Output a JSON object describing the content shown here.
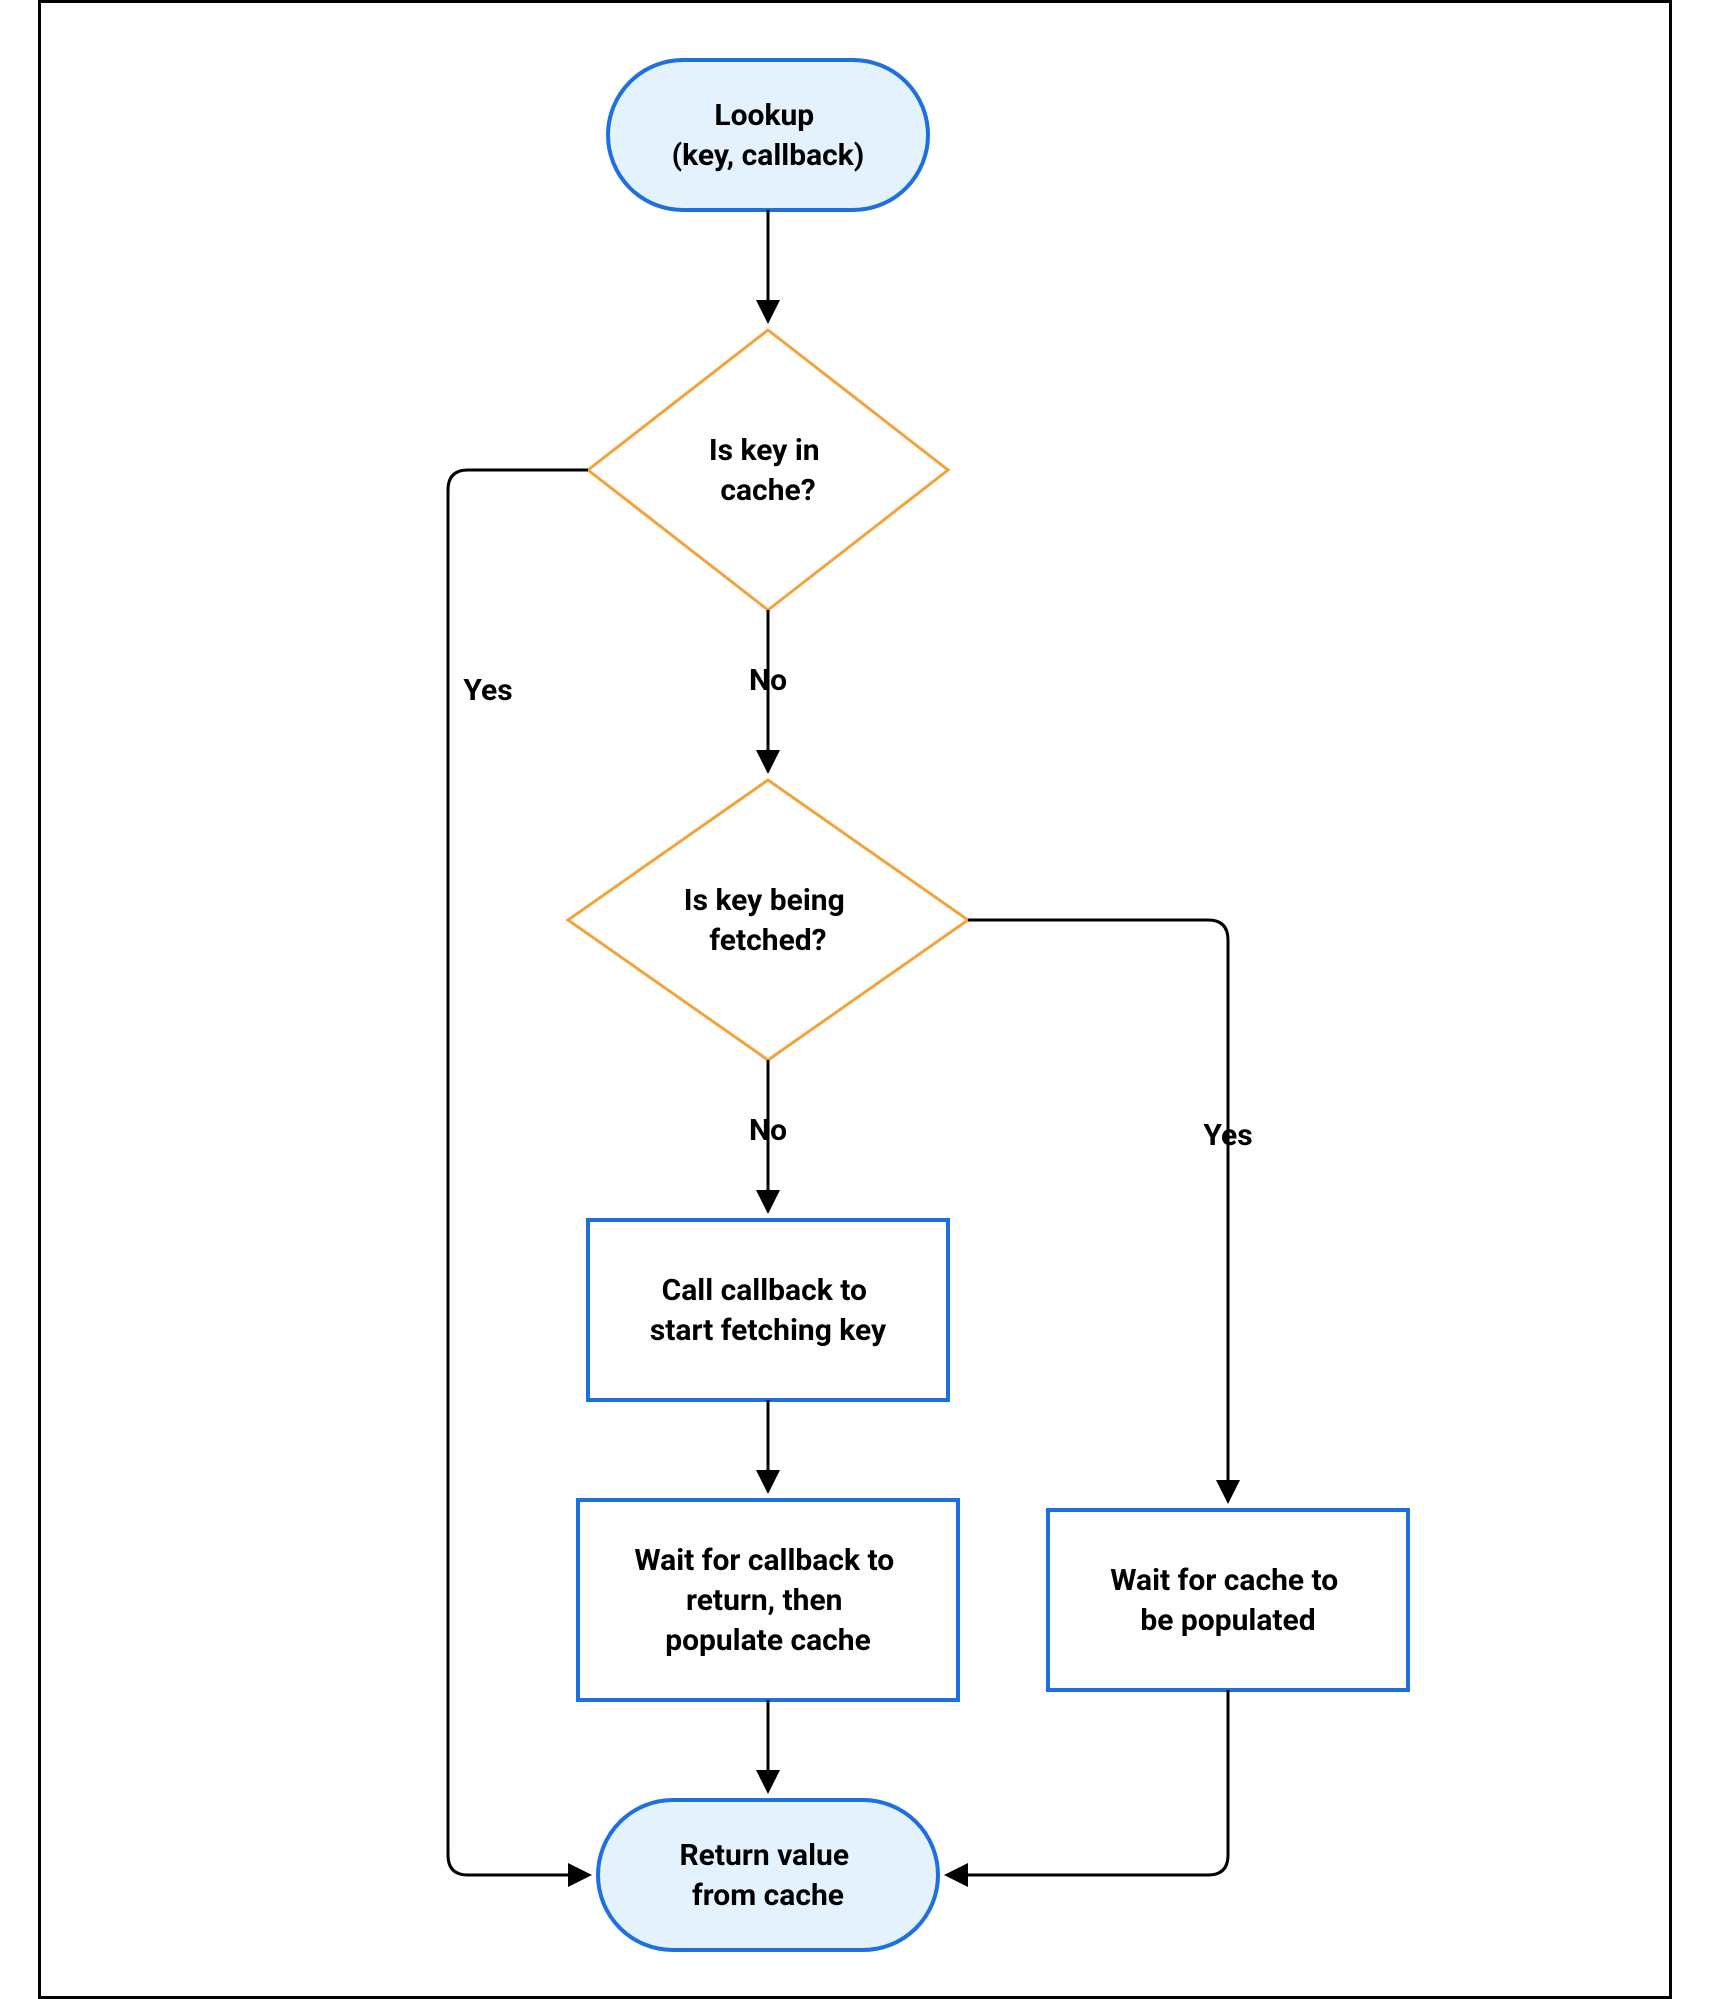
{
  "diagram": {
    "type": "flowchart",
    "nodes": {
      "start": {
        "shape": "terminator",
        "line1": "Lookup",
        "line2": "(key, callback)"
      },
      "decision1": {
        "shape": "decision",
        "line1": "Is key in",
        "line2": "cache?"
      },
      "decision2": {
        "shape": "decision",
        "line1": "Is key being",
        "line2": "fetched?"
      },
      "process1": {
        "shape": "process",
        "line1": "Call callback to",
        "line2": "start fetching key"
      },
      "process2": {
        "shape": "process",
        "line1": "Wait for callback to",
        "line2": "return, then",
        "line3": "populate cache"
      },
      "process3": {
        "shape": "process",
        "line1": "Wait for cache to",
        "line2": "be populated"
      },
      "end": {
        "shape": "terminator",
        "line1": "Return value",
        "line2": "from cache"
      }
    },
    "edges": {
      "e1": {
        "from": "start",
        "to": "decision1",
        "label": ""
      },
      "e2": {
        "from": "decision1",
        "to": "end",
        "label": "Yes",
        "path": "left-down"
      },
      "e3": {
        "from": "decision1",
        "to": "decision2",
        "label": "No"
      },
      "e4": {
        "from": "decision2",
        "to": "process1",
        "label": "No"
      },
      "e5": {
        "from": "decision2",
        "to": "process3",
        "label": "Yes",
        "path": "right-down"
      },
      "e6": {
        "from": "process1",
        "to": "process2",
        "label": ""
      },
      "e7": {
        "from": "process2",
        "to": "end",
        "label": ""
      },
      "e8": {
        "from": "process3",
        "to": "end",
        "label": "",
        "path": "down-left"
      }
    },
    "colors": {
      "terminator_fill": "#E3F2FD",
      "terminator_stroke": "#1E6FE0",
      "decision_stroke": "#F2A33C",
      "process_stroke": "#1E6FE0",
      "connector": "#000000"
    }
  }
}
